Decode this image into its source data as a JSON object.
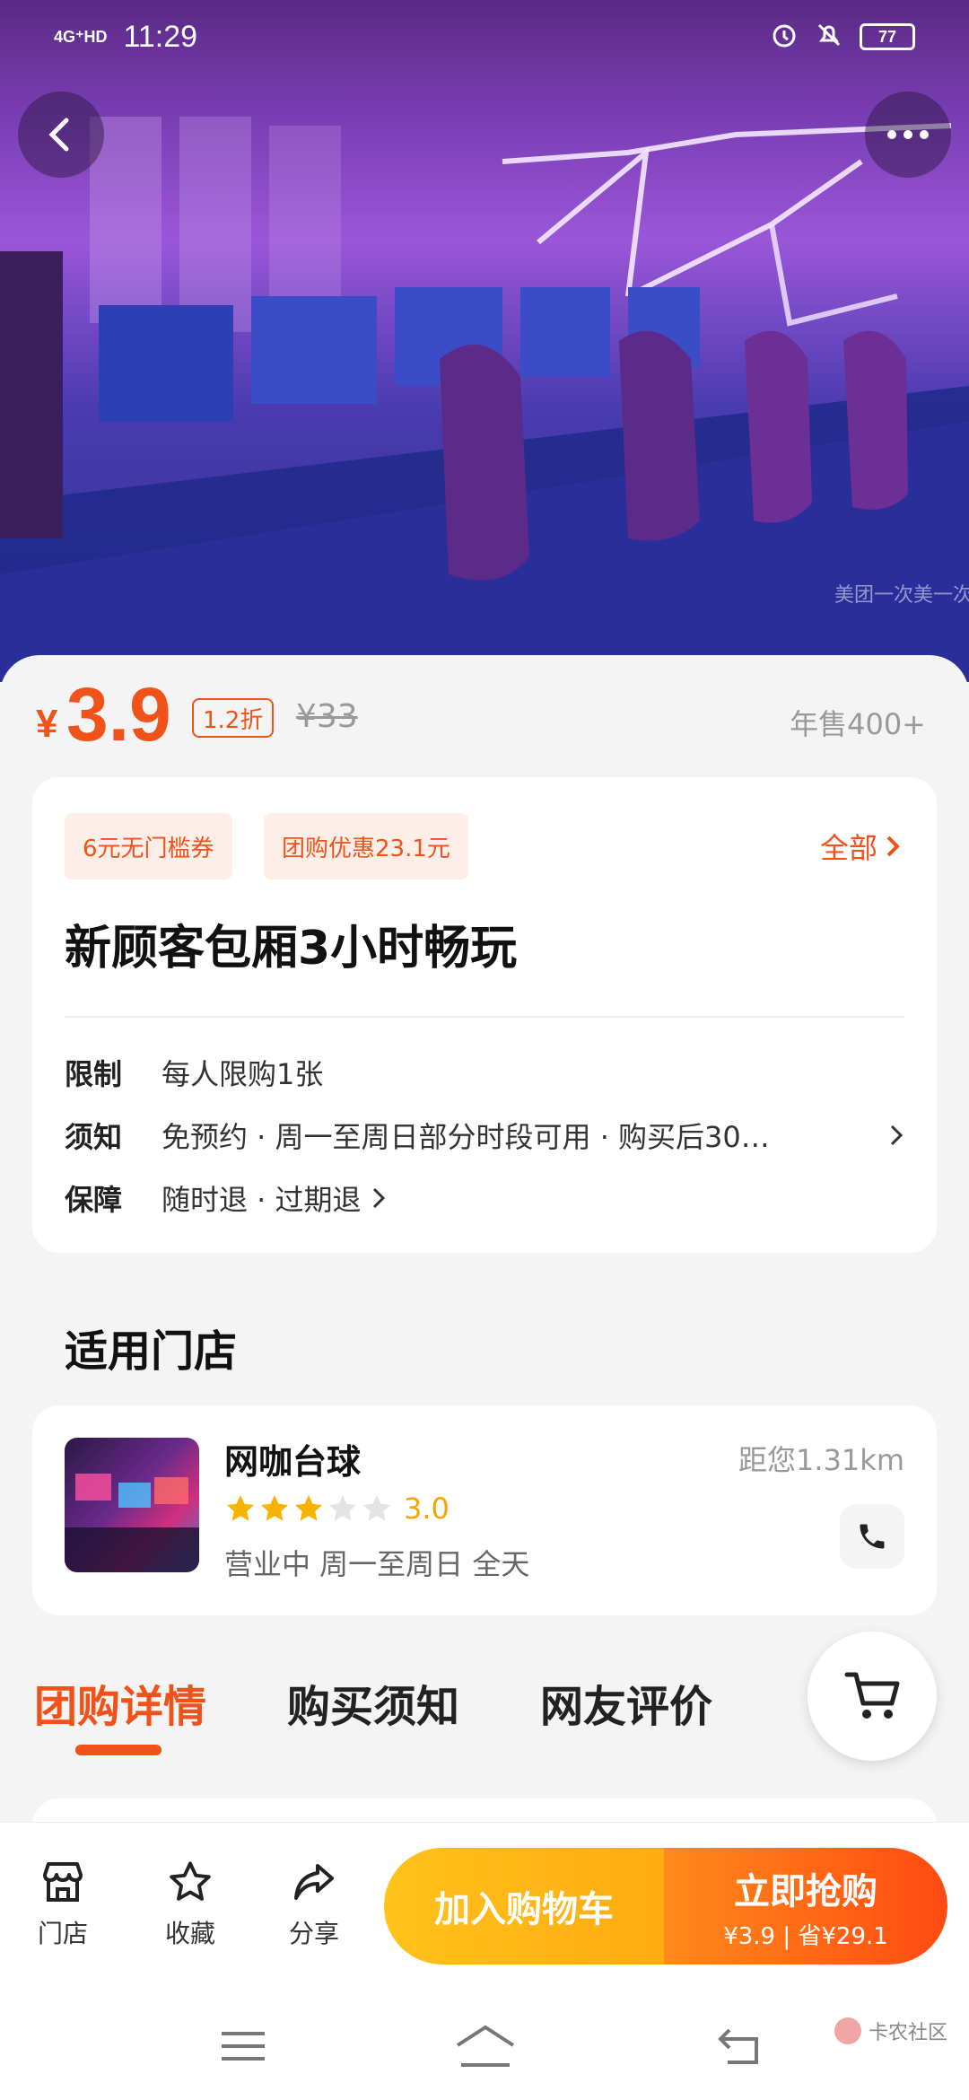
{
  "status_bar": {
    "network": "4G⁺HD",
    "time": "11:29",
    "battery": "77"
  },
  "hero": {
    "watermark": "美团一次美一次"
  },
  "price": {
    "symbol": "¥",
    "value": "3.9",
    "discount": "1.2折",
    "original": "¥33",
    "sales": "年售400+"
  },
  "product": {
    "coupons": [
      "6元无门槛券",
      "团购优惠23.1元"
    ],
    "coupons_all": "全部",
    "title": "新顾客包厢3小时畅玩",
    "info": [
      {
        "key": "限制",
        "value": "每人限购1张"
      },
      {
        "key": "须知",
        "value": "免预约 · 周一至周日部分时段可用 · 购买后30…"
      },
      {
        "key": "保障",
        "value": "随时退 · 过期退"
      }
    ]
  },
  "stores": {
    "section_title": "适用门店",
    "name": "网咖台球",
    "distance": "距您1.31km",
    "rating": "3.0",
    "rating_value": 3,
    "hours": "营业中  周一至周日 全天"
  },
  "tabs": [
    "团购详情",
    "购买须知",
    "网友评价"
  ],
  "action_bar": {
    "items": [
      {
        "label": "门店",
        "icon": "store-icon"
      },
      {
        "label": "收藏",
        "icon": "star-outline-icon"
      },
      {
        "label": "分享",
        "icon": "share-icon"
      }
    ],
    "add_to_cart": "加入购物车",
    "buy_now": "立即抢购",
    "buy_sub": "¥3.9 | 省¥29.1"
  },
  "watermark": "卡农社区",
  "colors": {
    "accent": "#f0521a",
    "star": "#f6a500",
    "cart_btn": "#ffb515",
    "buy_btn": "#ff5a14"
  }
}
